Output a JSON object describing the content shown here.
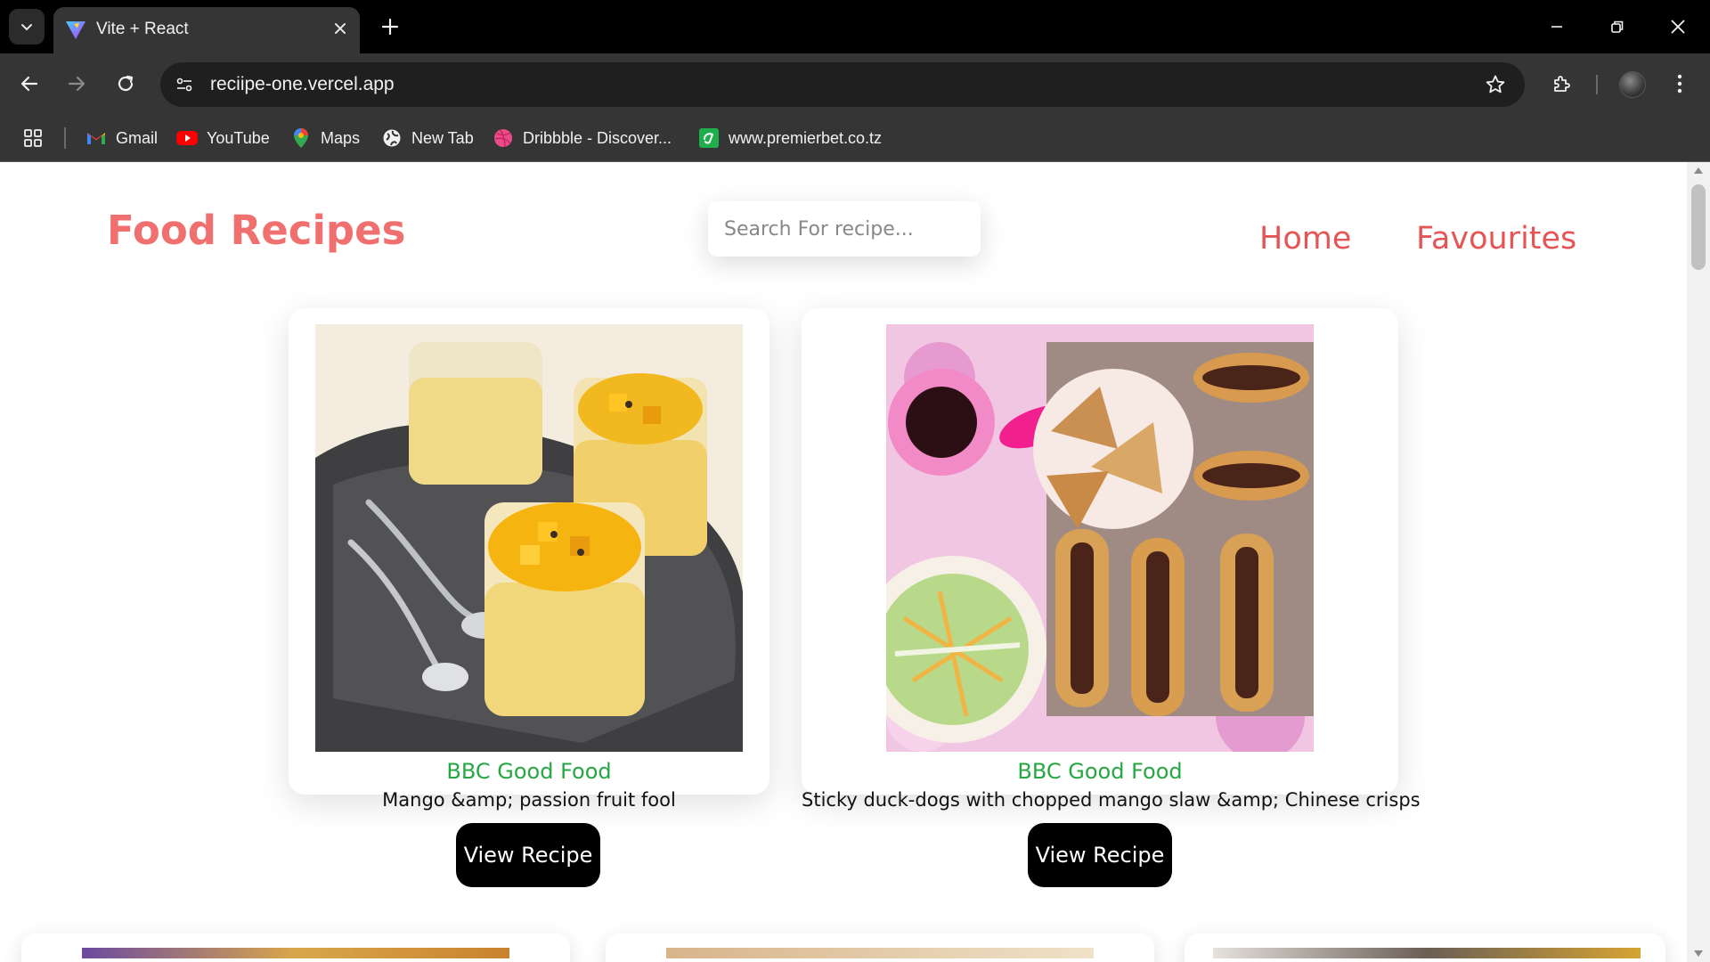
{
  "browser": {
    "tab_title": "Vite + React",
    "url": "reciipe-one.vercel.app",
    "bookmarks": [
      {
        "label": "Gmail",
        "icon": "gmail-icon"
      },
      {
        "label": "YouTube",
        "icon": "youtube-icon"
      },
      {
        "label": "Maps",
        "icon": "maps-icon"
      },
      {
        "label": "New Tab",
        "icon": "globe-icon"
      },
      {
        "label": "Dribbble - Discover...",
        "icon": "dribbble-icon"
      },
      {
        "label": "www.premierbet.co.tz",
        "icon": "premierbet-icon"
      }
    ]
  },
  "page": {
    "brand": "Food Recipes",
    "search_placeholder": "Search For recipe...",
    "nav": {
      "home": "Home",
      "favourites": "Favourites"
    },
    "recipes": [
      {
        "source": "BBC Good Food",
        "title": "Mango &amp; passion fruit fool",
        "button": "View Recipe",
        "image": "mango-passion-fruit-fool-photo"
      },
      {
        "source": "BBC Good Food",
        "title": "Sticky duck-dogs with chopped mango slaw &amp; Chinese crisps",
        "button": "View Recipe",
        "image": "sticky-duck-dogs-photo"
      }
    ]
  },
  "colors": {
    "brand": "#f07070",
    "nav": "#e55555",
    "source": "#27a744",
    "button_bg": "#000000"
  }
}
